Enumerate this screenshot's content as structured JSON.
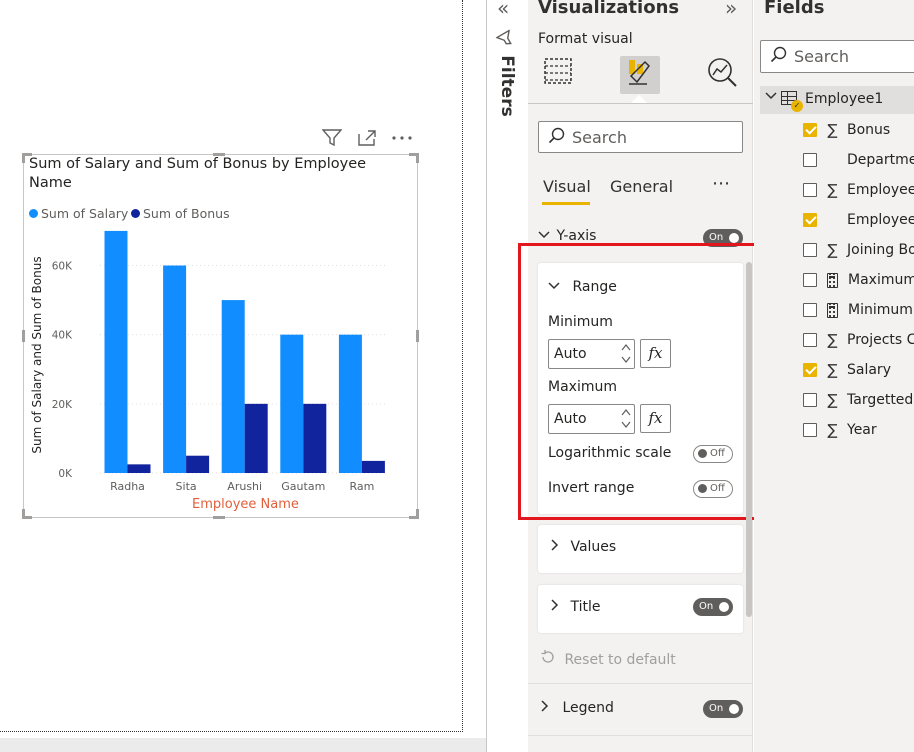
{
  "canvas": {
    "header_icons": [
      "filter-icon",
      "focus-mode-icon",
      "more-options-icon"
    ],
    "chart_data": {
      "type": "bar",
      "title": "Sum of Salary and Sum of Bonus by Employee Name",
      "xlabel": "Employee Name",
      "ylabel": "Sum of Salary and Sum of Bonus",
      "categories": [
        "Radha",
        "Sita",
        "Arushi",
        "Gautam",
        "Ram"
      ],
      "series": [
        {
          "name": "Sum of Salary",
          "values": [
            70000,
            60000,
            50000,
            40000,
            40000
          ],
          "color": "#118dff"
        },
        {
          "name": "Sum of Bonus",
          "values": [
            2500,
            5000,
            20000,
            20000,
            3500
          ],
          "color": "#12239e"
        }
      ],
      "yticks": [
        "0K",
        "20K",
        "40K",
        "60K"
      ],
      "ytick_values": [
        0,
        20000,
        40000,
        60000
      ],
      "ylim": [
        0,
        72000
      ],
      "grid": true,
      "legend_position": "top-left",
      "xlabel_color": "#e1603c"
    }
  },
  "filters": {
    "collapse_icon": "«",
    "label": "Filters"
  },
  "visualizations": {
    "title": "Visualizations",
    "expand_icon": "»",
    "format_label": "Format visual",
    "search_placeholder": "Search",
    "tabs": {
      "visual": "Visual",
      "general": "General",
      "more": "⋯"
    },
    "y_axis": {
      "label": "Y-axis",
      "toggle": "On"
    },
    "range": {
      "label": "Range",
      "minimum_label": "Minimum",
      "minimum_value": "Auto",
      "maximum_label": "Maximum",
      "maximum_value": "Auto",
      "fx": "fx",
      "log_label": "Logarithmic scale",
      "log_toggle": "Off",
      "invert_label": "Invert range",
      "invert_toggle": "Off"
    },
    "values_label": "Values",
    "title_label": "Title",
    "title_toggle": "On",
    "reset_label": "Reset to default",
    "legend_label": "Legend",
    "legend_toggle": "On",
    "accent_color": "#e8b400",
    "highlight_color": "#e3161e"
  },
  "fields": {
    "title": "Fields",
    "search_placeholder": "Search",
    "table_name": "Employee1",
    "items": [
      {
        "label": "Bonus",
        "checked": true,
        "icon": "sigma-icon"
      },
      {
        "label": "Departme",
        "checked": false,
        "icon": "none"
      },
      {
        "label": "Employee",
        "checked": false,
        "icon": "sigma-icon"
      },
      {
        "label": "Employee",
        "checked": true,
        "icon": "none"
      },
      {
        "label": "Joining Bo",
        "checked": false,
        "icon": "sigma-icon"
      },
      {
        "label": "Maximum",
        "checked": false,
        "icon": "calculator-icon"
      },
      {
        "label": "Minimum",
        "checked": false,
        "icon": "calculator-icon"
      },
      {
        "label": "Projects C",
        "checked": false,
        "icon": "sigma-icon"
      },
      {
        "label": "Salary",
        "checked": true,
        "icon": "sigma-icon"
      },
      {
        "label": "Targetted",
        "checked": false,
        "icon": "sigma-icon"
      },
      {
        "label": "Year",
        "checked": false,
        "icon": "sigma-icon"
      }
    ]
  }
}
